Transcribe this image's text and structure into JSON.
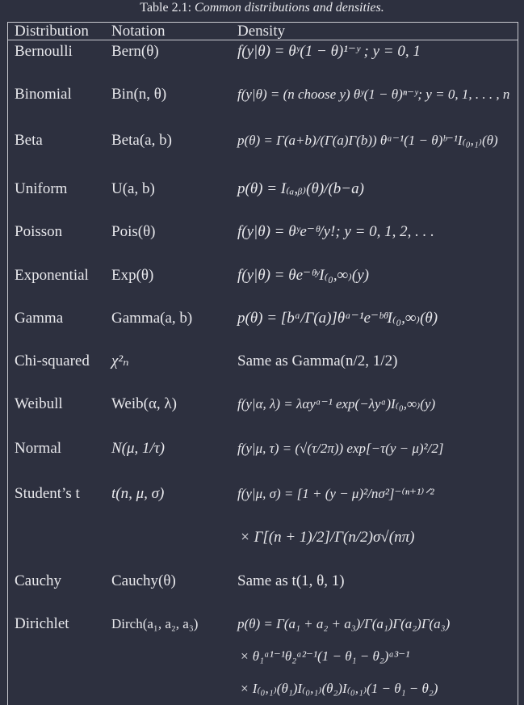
{
  "caption": {
    "label": "Table 2.1:",
    "title": "Common distributions and densities."
  },
  "headers": [
    "Distribution",
    "Notation",
    "Density"
  ],
  "rows": [
    {
      "distribution": "Bernoulli",
      "notation": "Bern(θ)",
      "density": "f(y|θ) = θʸ(1 − θ)¹⁻ʸ ; y = 0, 1"
    },
    {
      "distribution": "Binomial",
      "notation": "Bin(n, θ)",
      "density": "f(y|θ) = (n choose y) θʸ(1 − θ)ⁿ⁻ʸ; y = 0, 1, . . . , n"
    },
    {
      "distribution": "Beta",
      "notation": "Beta(a, b)",
      "density": "p(θ) = Γ(a+b)/(Γ(a)Γ(b)) θᵃ⁻¹(1 − θ)ᵇ⁻¹I₍₀,₁₎(θ)"
    },
    {
      "distribution": "Uniform",
      "notation": "U(a, b)",
      "density": "p(θ) = I₍ₐ,ᵦ₎(θ)/(b−a)"
    },
    {
      "distribution": "Poisson",
      "notation": "Pois(θ)",
      "density": "f(y|θ) = θʸe⁻ᶿ/y!; y = 0, 1, 2, . . ."
    },
    {
      "distribution": "Exponential",
      "notation": "Exp(θ)",
      "density": "f(y|θ) = θe⁻ᶿʸI₍₀,∞₎(y)"
    },
    {
      "distribution": "Gamma",
      "notation": "Gamma(a, b)",
      "density": "p(θ) = [bᵃ/Γ(a)]θᵃ⁻¹e⁻ᵇᶿI₍₀,∞₎(θ)"
    },
    {
      "distribution": "Chi-squared",
      "notation": "χ²ₙ",
      "density": "Same as Gamma(n/2, 1/2)"
    },
    {
      "distribution": "Weibull",
      "notation": "Weib(α, λ)",
      "density": "f(y|α, λ) = λαyᵅ⁻¹ exp(−λyᵅ)I₍₀,∞₎(y)"
    },
    {
      "distribution": "Normal",
      "notation": "N(μ, 1/τ)",
      "density": "f(y|μ, τ) = (√(τ/2π)) exp[−τ(y − μ)²/2]"
    },
    {
      "distribution": "Student’s t",
      "notation": "t(n, μ, σ)",
      "density": "f(y|μ, σ) = [1 + (y − μ)²/nσ²]⁻⁽ⁿ⁺¹⁾ᐟ²",
      "density_cont": [
        "× Γ[(n + 1)/2]/Γ(n/2)σ√(nπ)"
      ]
    },
    {
      "distribution": "Cauchy",
      "notation": "Cauchy(θ)",
      "density": "Same as t(1, θ, 1)"
    },
    {
      "distribution": "Dirichlet",
      "notation": "Dirch(a₁, a₂, a₃)",
      "density": "p(θ) = Γ(a₁ + a₂ + a₃)/Γ(a₁)Γ(a₂)Γ(a₃)",
      "density_cont": [
        "× θ₁ᵃ¹⁻¹θ₂ᵃ²⁻¹(1 − θ₁ − θ₂)ᵃ³⁻¹",
        "× I₍₀,₁₎(θ₁)I₍₀,₁₎(θ₂)I₍₀,₁₎(1 − θ₁ − θ₂)"
      ]
    }
  ]
}
